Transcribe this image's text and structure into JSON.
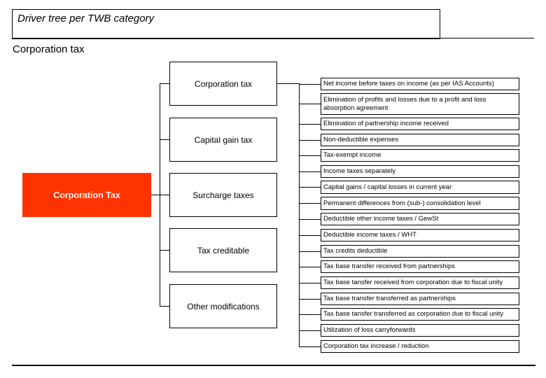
{
  "header": {
    "title": "Driver tree per TWB category",
    "subtitle": "Corporation tax"
  },
  "tree": {
    "root": {
      "label": "Corporation Tax",
      "color": "#ff3300"
    },
    "level2": [
      {
        "label": "Corporation tax"
      },
      {
        "label": "Capital gain tax"
      },
      {
        "label": "Surcharge taxes"
      },
      {
        "label": "Tax creditable"
      },
      {
        "label": "Other modifications"
      }
    ],
    "leaves": [
      {
        "label": "Net income before taxes on income (as per IAS Accounts)"
      },
      {
        "label": "Elimination of profits and losses due to a profit and loss absorption agreement"
      },
      {
        "label": "Elimination of partnership income received"
      },
      {
        "label": "Non-deductible expenses"
      },
      {
        "label": "Tax-exempt income"
      },
      {
        "label": "Income taxes separately"
      },
      {
        "label": "Capital gains / capital losses in current year"
      },
      {
        "label": "Permanent differences from (sub-) consolidation level"
      },
      {
        "label": "Deductible other income taxes / GewSt"
      },
      {
        "label": "Deductible income taxes / WHT"
      },
      {
        "label": "Tax credits deductible"
      },
      {
        "label": "Tax base transfer received from partnerships"
      },
      {
        "label": "Tax base tansfer received from corporation due to fiscal unity"
      },
      {
        "label": "Tax base transfer transferred as partnerships"
      },
      {
        "label": "Tax base tansfer transferred as corporation due to fiscal unity"
      },
      {
        "label": "Utilization of loss carryforwards"
      },
      {
        "label": "Corporation tax increase / reduction"
      }
    ]
  }
}
